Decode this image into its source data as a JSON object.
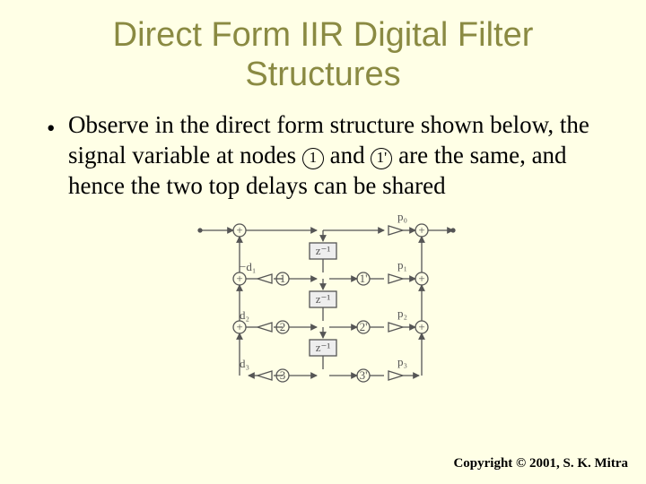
{
  "title": "Direct Form IIR Digital Filter Structures",
  "bullet": {
    "dot": "•",
    "segments": {
      "s1": "Observe in the direct form structure shown below, the signal variable at nodes ",
      "node1": "1",
      "s2": " and ",
      "node2": "1'",
      "s3": " are the same, and hence the two top delays can be shared"
    }
  },
  "diagram": {
    "coeffs_left": [
      "−d₁",
      "d₂",
      "d₃"
    ],
    "coeffs_right": [
      "p₀",
      "p₁",
      "p₂",
      "p₃"
    ],
    "delay_label": "z⁻¹",
    "node_labels_left": [
      "1",
      "2",
      "3"
    ],
    "node_labels_right": [
      "1'",
      "2'",
      "3'"
    ]
  },
  "copyright": "Copyright © 2001, S. K. Mitra"
}
